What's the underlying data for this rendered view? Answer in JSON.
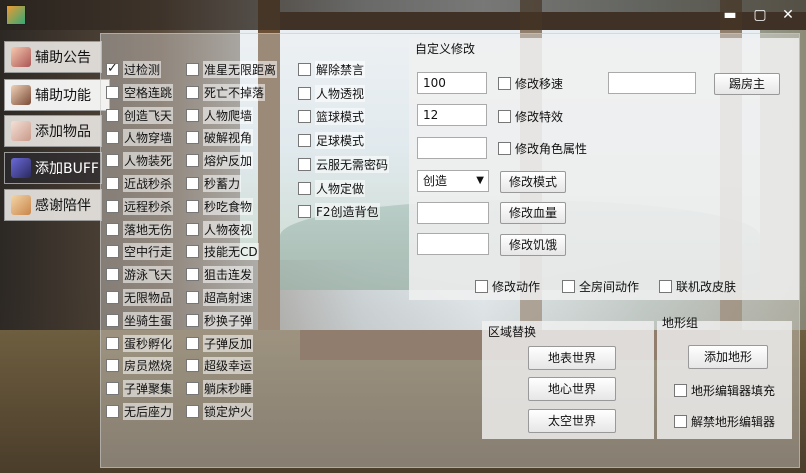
{
  "window": {
    "minimize_glyph": "▬",
    "maximize_glyph": "▢",
    "close_glyph": "✕"
  },
  "sidebar": {
    "items": [
      {
        "label": "辅助公告"
      },
      {
        "label": "辅助功能"
      },
      {
        "label": "添加物品"
      },
      {
        "label": "添加BUFF"
      },
      {
        "label": "感谢陪伴"
      }
    ]
  },
  "features": {
    "col1": [
      {
        "label": "过检测",
        "checked": true
      },
      {
        "label": "空格连跳"
      },
      {
        "label": "创造飞天"
      },
      {
        "label": "人物穿墙"
      },
      {
        "label": "人物装死"
      },
      {
        "label": "近战秒杀"
      },
      {
        "label": "远程秒杀"
      },
      {
        "label": "落地无伤"
      },
      {
        "label": "空中行走"
      },
      {
        "label": "游泳飞天"
      },
      {
        "label": "无限物品"
      },
      {
        "label": "坐骑生蛋"
      },
      {
        "label": "蛋秒孵化"
      },
      {
        "label": "房员燃烧"
      },
      {
        "label": "子弹聚集"
      },
      {
        "label": "无后座力"
      }
    ],
    "col2": [
      {
        "label": "准星无限距离"
      },
      {
        "label": "死亡不掉落"
      },
      {
        "label": "人物爬墙"
      },
      {
        "label": "破解视角"
      },
      {
        "label": "熔炉反加"
      },
      {
        "label": "秒蓄力"
      },
      {
        "label": "秒吃食物"
      },
      {
        "label": "人物夜视"
      },
      {
        "label": "技能无CD"
      },
      {
        "label": "狙击连发"
      },
      {
        "label": "超高射速"
      },
      {
        "label": "秒换子弹"
      },
      {
        "label": "子弹反加"
      },
      {
        "label": "超级幸运"
      },
      {
        "label": "躺床秒睡"
      },
      {
        "label": "锁定炉火"
      }
    ],
    "col3": [
      {
        "label": "解除禁言"
      },
      {
        "label": "人物透视"
      },
      {
        "label": "篮球模式"
      },
      {
        "label": "足球模式"
      },
      {
        "label": "云服无需密码"
      },
      {
        "label": "人物定做"
      },
      {
        "label": "F2创造背包"
      }
    ]
  },
  "custom": {
    "title": "自定义修改",
    "speed_value": "100",
    "speed_label": "修改移速",
    "effect_value": "12",
    "effect_label": "修改特效",
    "attr_value": "",
    "attr_label": "修改角色属性",
    "kick_value": "",
    "kick_button": "踢房主",
    "mode_select": "创造",
    "mode_button": "修改模式",
    "hp_value": "",
    "hp_button": "修改血量",
    "hunger_value": "",
    "hunger_button": "修改饥饿",
    "action_label": "修改动作",
    "room_action_label": "全房间动作",
    "skin_label": "联机改皮肤"
  },
  "region": {
    "title": "区域替换",
    "surface": "地表世界",
    "core": "地心世界",
    "space": "太空世界"
  },
  "terrain": {
    "title": "地形组",
    "add": "添加地形",
    "fill_label": "地形编辑器填充",
    "unlock_label": "解禁地形编辑器"
  },
  "colors": {
    "panel": "#f0f0f0",
    "titlebar": "#28201c"
  }
}
